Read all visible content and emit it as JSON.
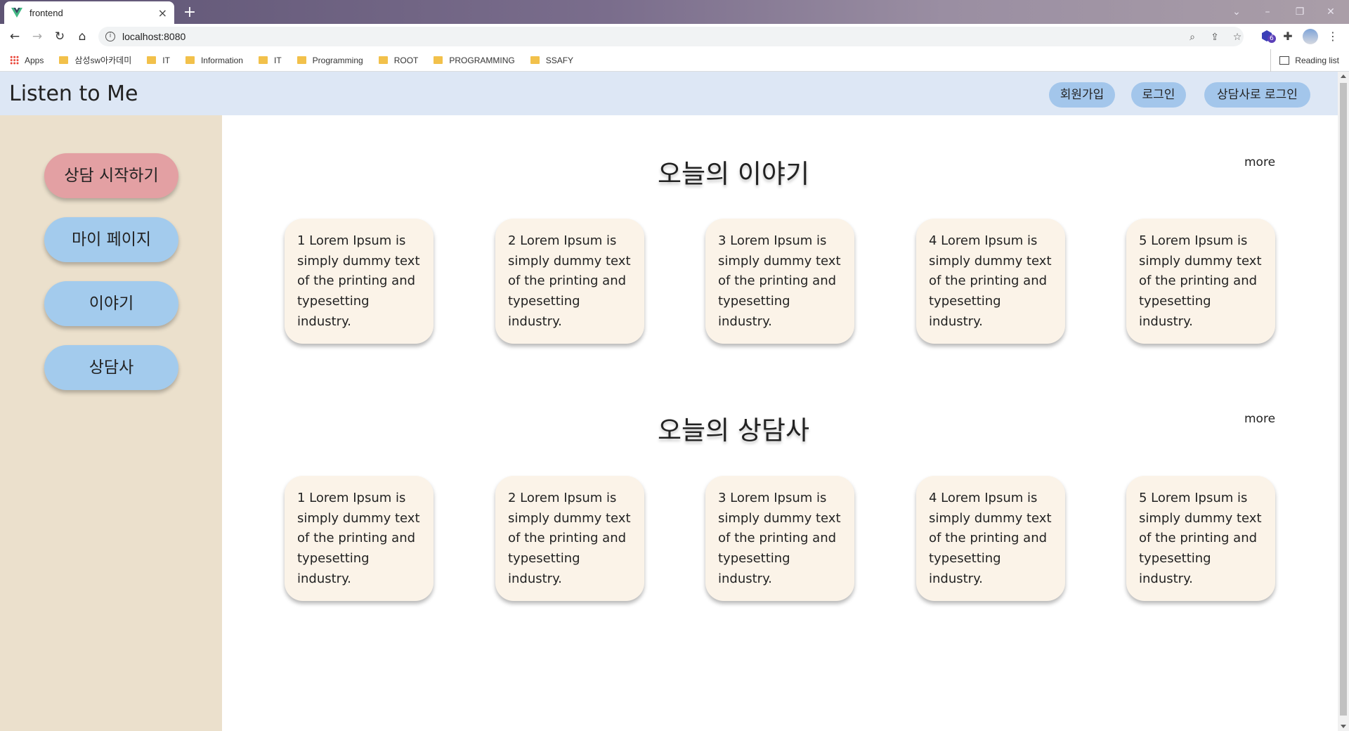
{
  "browser": {
    "tab_title": "frontend",
    "url": "localhost:8080",
    "bookmarks": [
      "Apps",
      "삼성sw아카데미",
      "IT",
      "Information",
      "IT",
      "Programming",
      "ROOT",
      "PROGRAMMING",
      "SSAFY"
    ],
    "reading_list": "Reading list",
    "extension_badge": "6"
  },
  "header": {
    "title": "Listen to Me",
    "signup": "회원가입",
    "login": "로그인",
    "counselor_login": "상담사로 로그인"
  },
  "sidebar": {
    "items": [
      {
        "label": "상담 시작하기"
      },
      {
        "label": "마이 페이지"
      },
      {
        "label": "이야기"
      },
      {
        "label": "상담사"
      }
    ]
  },
  "sections": [
    {
      "title": "오늘의 이야기",
      "more": "more",
      "cards": [
        "1 Lorem Ipsum is simply dummy text of the printing and typesetting industry.",
        "2 Lorem Ipsum is simply dummy text of the printing and typesetting industry.",
        "3 Lorem Ipsum is simply dummy text of the printing and typesetting industry.",
        "4 Lorem Ipsum is simply dummy text of the printing and typesetting industry.",
        "5 Lorem Ipsum is simply dummy text of the printing and typesetting industry."
      ]
    },
    {
      "title": "오늘의 상담사",
      "more": "more",
      "cards": [
        "1 Lorem Ipsum is simply dummy text of the printing and typesetting industry.",
        "2 Lorem Ipsum is simply dummy text of the printing and typesetting industry.",
        "3 Lorem Ipsum is simply dummy text of the printing and typesetting industry.",
        "4 Lorem Ipsum is simply dummy text of the printing and typesetting industry.",
        "5 Lorem Ipsum is simply dummy text of the printing and typesetting industry."
      ]
    }
  ],
  "colors": {
    "header_bg": "#dde7f5",
    "sidebar_bg": "#ebe0cc",
    "button_blue": "#a3cbed",
    "button_pink": "#e3a0a3",
    "card_bg": "#fbf3e8"
  }
}
